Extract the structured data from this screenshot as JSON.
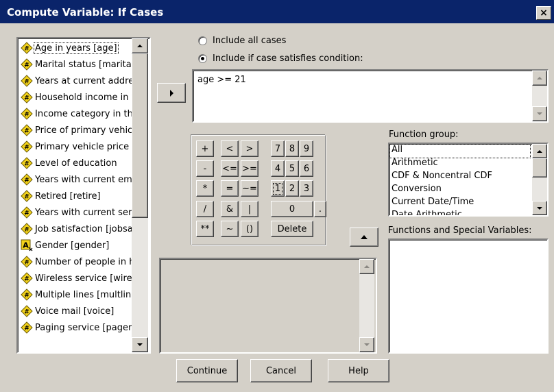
{
  "window": {
    "title": "Compute Variable: If Cases",
    "close_label": "×"
  },
  "variables": [
    {
      "label": "Age in years [age]",
      "type": "scale",
      "icon": "scale-ruler-icon"
    },
    {
      "label": "Marital status [marital]",
      "type": "scale",
      "icon": "scale-ruler-icon"
    },
    {
      "label": "Years at current address",
      "type": "scale",
      "icon": "scale-ruler-icon"
    },
    {
      "label": "Household income in thousands",
      "type": "scale",
      "icon": "scale-ruler-icon"
    },
    {
      "label": "Income category in thousands",
      "type": "scale",
      "icon": "scale-ruler-icon"
    },
    {
      "label": "Price of primary vehicle",
      "type": "scale",
      "icon": "scale-ruler-icon"
    },
    {
      "label": "Primary vehicle price category",
      "type": "scale",
      "icon": "scale-ruler-icon"
    },
    {
      "label": "Level of education",
      "type": "scale",
      "icon": "scale-ruler-icon"
    },
    {
      "label": "Years with current employer",
      "type": "scale",
      "icon": "scale-ruler-icon"
    },
    {
      "label": "Retired [retire]",
      "type": "scale",
      "icon": "scale-ruler-icon"
    },
    {
      "label": "Years with current service",
      "type": "scale",
      "icon": "scale-ruler-icon"
    },
    {
      "label": "Job satisfaction [jobsat]",
      "type": "scale",
      "icon": "scale-ruler-icon"
    },
    {
      "label": "Gender [gender]",
      "type": "string",
      "icon": "string-a-icon"
    },
    {
      "label": "Number of people in household",
      "type": "scale",
      "icon": "scale-ruler-icon"
    },
    {
      "label": "Wireless service [wireless]",
      "type": "scale",
      "icon": "scale-ruler-icon"
    },
    {
      "label": "Multiple lines [multline]",
      "type": "scale",
      "icon": "scale-ruler-icon"
    },
    {
      "label": "Voice mail [voice]",
      "type": "scale",
      "icon": "scale-ruler-icon"
    },
    {
      "label": "Paging service [pager]",
      "type": "scale",
      "icon": "scale-ruler-icon"
    }
  ],
  "case_options": {
    "include_all": "Include all cases",
    "include_if": "Include if case satisfies condition:",
    "selected": "include_if"
  },
  "condition": {
    "expression": "age >= 21"
  },
  "keypad": {
    "rows": [
      [
        "+",
        "<",
        ">",
        "7",
        "8",
        "9"
      ],
      [
        "-",
        "<=",
        ">=",
        "4",
        "5",
        "6"
      ],
      [
        "*",
        "=",
        "~=",
        "1",
        "2",
        "3"
      ],
      [
        "/",
        "&",
        "|",
        "0",
        "."
      ],
      [
        "**",
        "~",
        "()",
        "Delete"
      ]
    ]
  },
  "function_group": {
    "label": "Function group:",
    "items": [
      "All",
      "Arithmetic",
      "CDF & Noncentral CDF",
      "Conversion",
      "Current Date/Time",
      "Date Arithmetic"
    ]
  },
  "functions": {
    "label": "Functions and Special Variables:"
  },
  "buttons": {
    "continue": "Continue",
    "cancel": "Cancel",
    "help": "Help"
  }
}
